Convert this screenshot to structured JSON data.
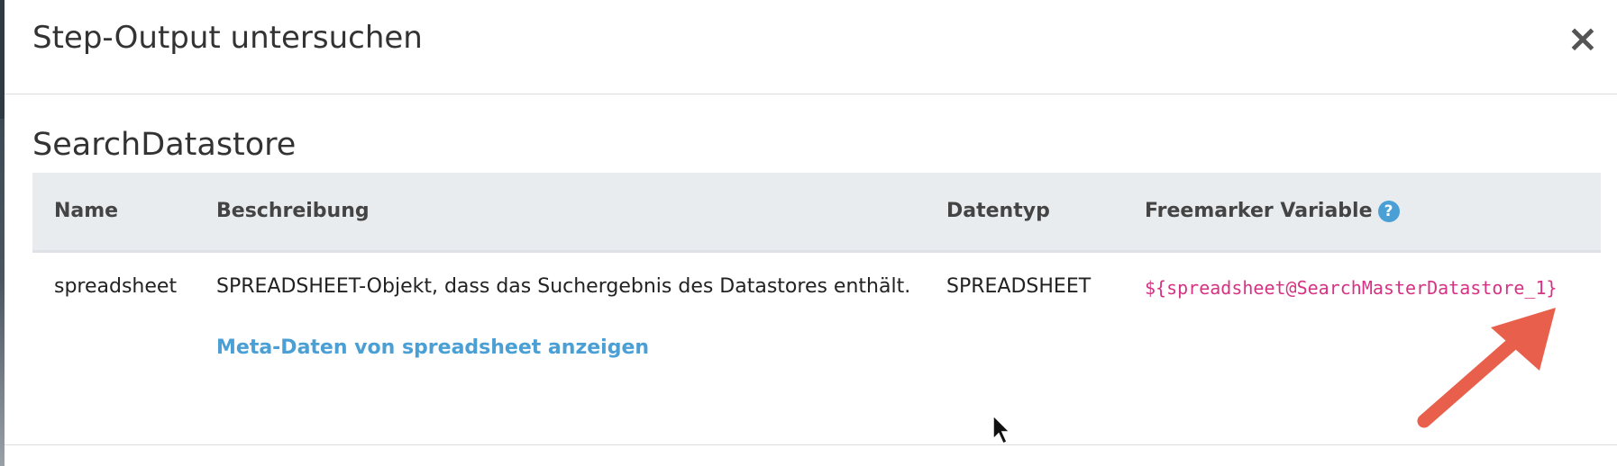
{
  "modal": {
    "title": "Step-Output untersuchen",
    "close_label": "×"
  },
  "section": {
    "title": "SearchDatastore"
  },
  "table": {
    "headers": {
      "name": "Name",
      "description": "Beschreibung",
      "datatype": "Datentyp",
      "variable": "Freemarker Variable"
    },
    "help_label": "?",
    "rows": [
      {
        "name": "spreadsheet",
        "description": "SPREADSHEET-Objekt, dass das Suchergebnis des Datastores enthält.",
        "datatype": "SPREADSHEET",
        "variable": "${spreadsheet@SearchMasterDatastore_1}",
        "meta_link": "Meta-Daten von spreadsheet anzeigen"
      }
    ]
  },
  "colors": {
    "link": "#4a9fd5",
    "code": "#d63384",
    "annotation_arrow": "#e8604c",
    "header_bg": "#e9ecef"
  }
}
